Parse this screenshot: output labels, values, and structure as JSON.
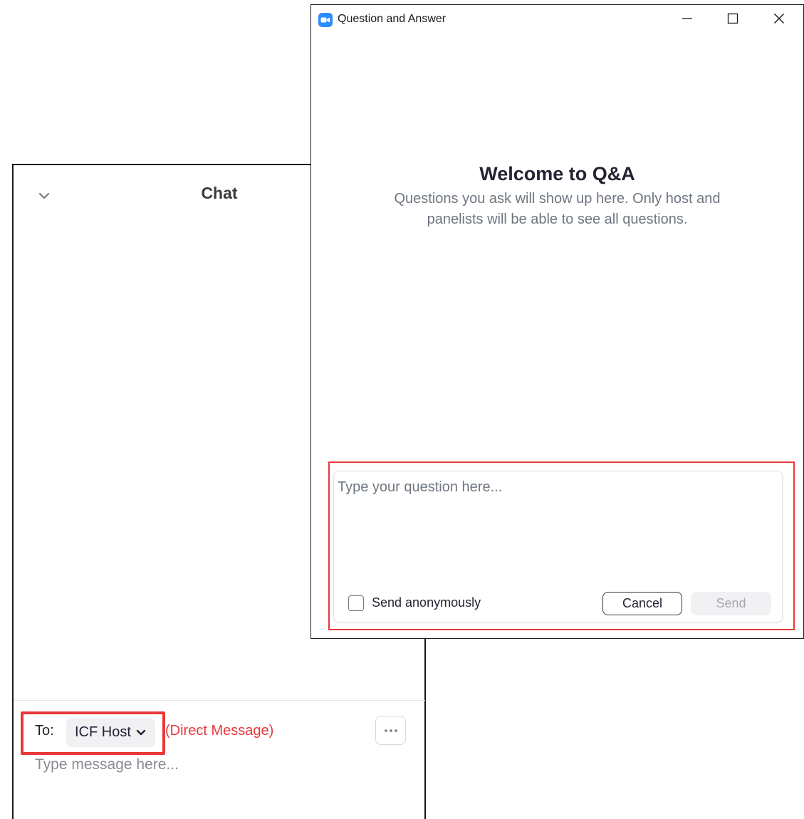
{
  "chat": {
    "title": "Chat",
    "to_label": "To:",
    "recipient": "ICF Host",
    "direct_message": "(Direct Message)",
    "more_label": "···",
    "input_placeholder": "Type message here..."
  },
  "qa_window": {
    "title": "Question and Answer",
    "welcome_title": "Welcome to Q&A",
    "welcome_line1": "Questions you ask will show up here. Only host and",
    "welcome_line2": "panelists will be able to see all questions.",
    "input_placeholder": "Type your question here...",
    "anonymous_label": "Send anonymously",
    "cancel_label": "Cancel",
    "send_label": "Send"
  },
  "icons": {
    "app": "zoom-camera-icon",
    "minimize": "minimize-icon",
    "maximize": "maximize-icon",
    "close": "close-icon",
    "collapse": "chevron-down-icon",
    "recipient_dropdown": "chevron-down-icon",
    "more": "more-options-icon"
  },
  "colors": {
    "highlight": "#e8383a",
    "direct_message": "#e8383a",
    "zoom_blue": "#2d8cff"
  }
}
